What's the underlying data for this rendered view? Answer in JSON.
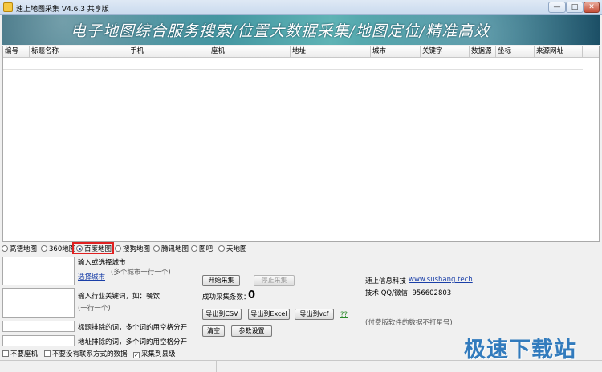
{
  "window": {
    "title": "速上地图采集 V4.6.3 共享版",
    "minimize": "—",
    "maximize": "□",
    "close": "✕"
  },
  "banner": {
    "text": "电子地图综合服务搜索/位置大数据采集/地图定位/精准高效"
  },
  "table": {
    "columns": [
      "编号",
      "标题名称",
      "手机",
      "座机",
      "地址",
      "城市",
      "关键字",
      "数据源",
      "坐标",
      "来源网址"
    ]
  },
  "maps": {
    "selected": "百度地图",
    "options": [
      "高德地图",
      "360地图",
      "百度地图",
      "搜狗地图",
      "腾讯地图",
      "图吧",
      "天地图"
    ]
  },
  "city": {
    "label": "输入或选择城市",
    "hint": "(多个城市一行一个)",
    "select_link": "选择城市"
  },
  "keyword": {
    "label": "输入行业关键词，如：餐饮",
    "hint": "(一行一个)"
  },
  "exclude": {
    "title_label": "标题排除的词，多个词的用空格分开",
    "address_label": "地址排除的词，多个词的用空格分开"
  },
  "actions": {
    "start": "开始采集",
    "stop": "停止采集",
    "success_label": "成功采集条数：",
    "success_count": "0",
    "export_csv": "导出到CSV",
    "export_excel": "导出到Excel",
    "export_vcf": "导出到vcf",
    "help": "??",
    "clear": "清空",
    "settings": "参数设置"
  },
  "info": {
    "company": "速上信息科技",
    "website": "www.sushang.tech",
    "support": "技术 QQ/微信: 956602803",
    "note": "(付费版软件的数据不打星号)"
  },
  "options": {
    "no_landline": "不要座机",
    "no_contact": "不要没有联系方式的数据",
    "county_level": "采集到县级"
  },
  "watermark": "极速下载站"
}
